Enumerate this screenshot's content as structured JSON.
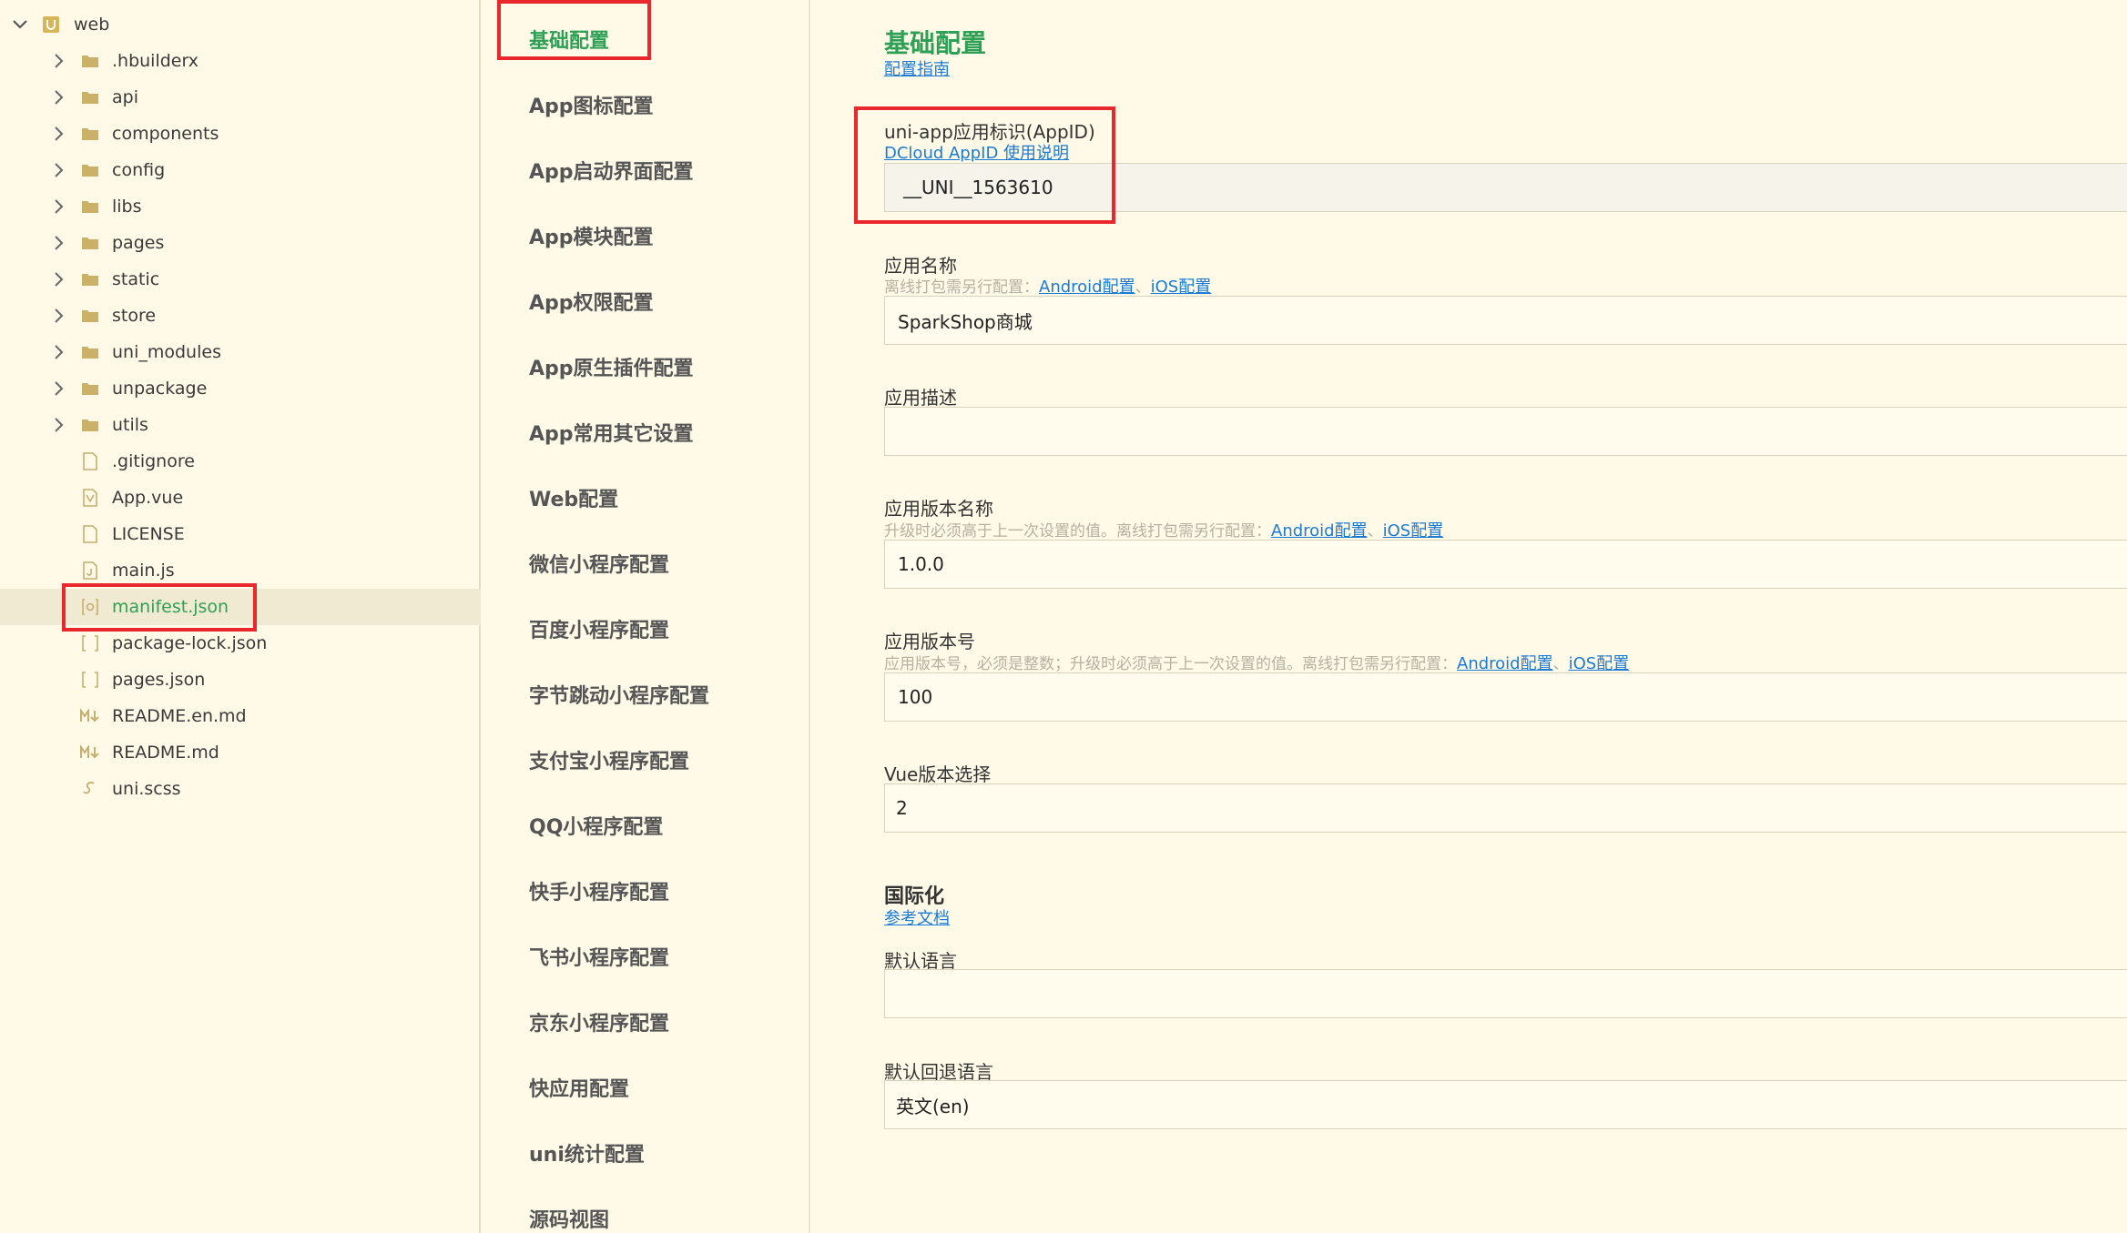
{
  "tree": {
    "root_label": "web",
    "items": [
      {
        "label": ".hbuilderx",
        "kind": "folder"
      },
      {
        "label": "api",
        "kind": "folder"
      },
      {
        "label": "components",
        "kind": "folder"
      },
      {
        "label": "config",
        "kind": "folder"
      },
      {
        "label": "libs",
        "kind": "folder"
      },
      {
        "label": "pages",
        "kind": "folder"
      },
      {
        "label": "static",
        "kind": "folder"
      },
      {
        "label": "store",
        "kind": "folder"
      },
      {
        "label": "uni_modules",
        "kind": "folder"
      },
      {
        "label": "unpackage",
        "kind": "folder"
      },
      {
        "label": "utils",
        "kind": "folder"
      },
      {
        "label": ".gitignore",
        "kind": "file"
      },
      {
        "label": "App.vue",
        "kind": "vue"
      },
      {
        "label": "LICENSE",
        "kind": "file"
      },
      {
        "label": "main.js",
        "kind": "js"
      },
      {
        "label": "manifest.json",
        "kind": "manifest",
        "selected": true
      },
      {
        "label": "package-lock.json",
        "kind": "json"
      },
      {
        "label": "pages.json",
        "kind": "json"
      },
      {
        "label": "README.en.md",
        "kind": "md"
      },
      {
        "label": "README.md",
        "kind": "md"
      },
      {
        "label": "uni.scss",
        "kind": "scss"
      }
    ]
  },
  "nav": {
    "items": [
      {
        "label": "基础配置",
        "active": true
      },
      {
        "label": "App图标配置"
      },
      {
        "label": "App启动界面配置"
      },
      {
        "label": "App模块配置"
      },
      {
        "label": "App权限配置"
      },
      {
        "label": "App原生插件配置"
      },
      {
        "label": "App常用其它设置"
      },
      {
        "label": "Web配置"
      },
      {
        "label": "微信小程序配置"
      },
      {
        "label": "百度小程序配置"
      },
      {
        "label": "字节跳动小程序配置"
      },
      {
        "label": "支付宝小程序配置"
      },
      {
        "label": "QQ小程序配置"
      },
      {
        "label": "快手小程序配置"
      },
      {
        "label": "飞书小程序配置"
      },
      {
        "label": "京东小程序配置"
      },
      {
        "label": "快应用配置"
      },
      {
        "label": "uni统计配置"
      },
      {
        "label": "源码视图"
      }
    ]
  },
  "form": {
    "title": "基础配置",
    "guide_link": "配置指南",
    "appid": {
      "label": "uni-app应用标识(AppID)",
      "link": "DCloud AppID 使用说明",
      "value": "__UNI__1563610"
    },
    "app_name": {
      "label": "应用名称",
      "hint": "离线打包需另行配置：",
      "link_android": "Android配置",
      "sep": "、",
      "link_ios": "iOS配置",
      "value": "SparkShop商城"
    },
    "app_desc": {
      "label": "应用描述",
      "value": ""
    },
    "version_name": {
      "label": "应用版本名称",
      "hint": "升级时必须高于上一次设置的值。离线打包需另行配置：",
      "link_android": "Android配置",
      "sep": "、",
      "link_ios": "iOS配置",
      "value": "1.0.0"
    },
    "version_code": {
      "label": "应用版本号",
      "hint": "应用版本号，必须是整数；升级时必须高于上一次设置的值。离线打包需另行配置：",
      "link_android": "Android配置",
      "sep": "、",
      "link_ios": "iOS配置",
      "value": "100"
    },
    "vue_version": {
      "label": "Vue版本选择",
      "value": "2"
    },
    "i18n": {
      "title": "国际化",
      "doc_link": "参考文档",
      "default_lang_label": "默认语言",
      "default_lang_value": "",
      "fallback_lang_label": "默认回退语言",
      "fallback_lang_value": "英文(en)"
    }
  },
  "colors": {
    "background": "#fffae8",
    "accent_green": "#2ea055",
    "link_blue": "#1a7bd6",
    "highlight_red": "#e8282c"
  }
}
